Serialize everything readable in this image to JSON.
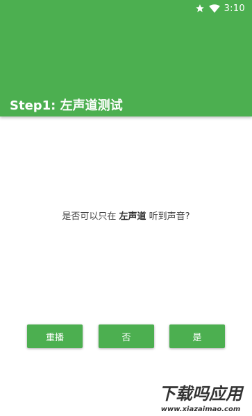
{
  "status_bar": {
    "time": "3:10",
    "icons": [
      "star-icon",
      "wifi-icon"
    ]
  },
  "app_bar": {
    "title": "Step1: 左声道测试",
    "color": "#4caf50"
  },
  "question": {
    "prefix": "是否可以只在 ",
    "emphasis": "左声道",
    "suffix": " 听到声音?"
  },
  "buttons": {
    "replay": "重播",
    "no": "否",
    "yes": "是"
  },
  "watermark": {
    "title": "下载吗应用",
    "url": "www.xiazaimao.com"
  }
}
